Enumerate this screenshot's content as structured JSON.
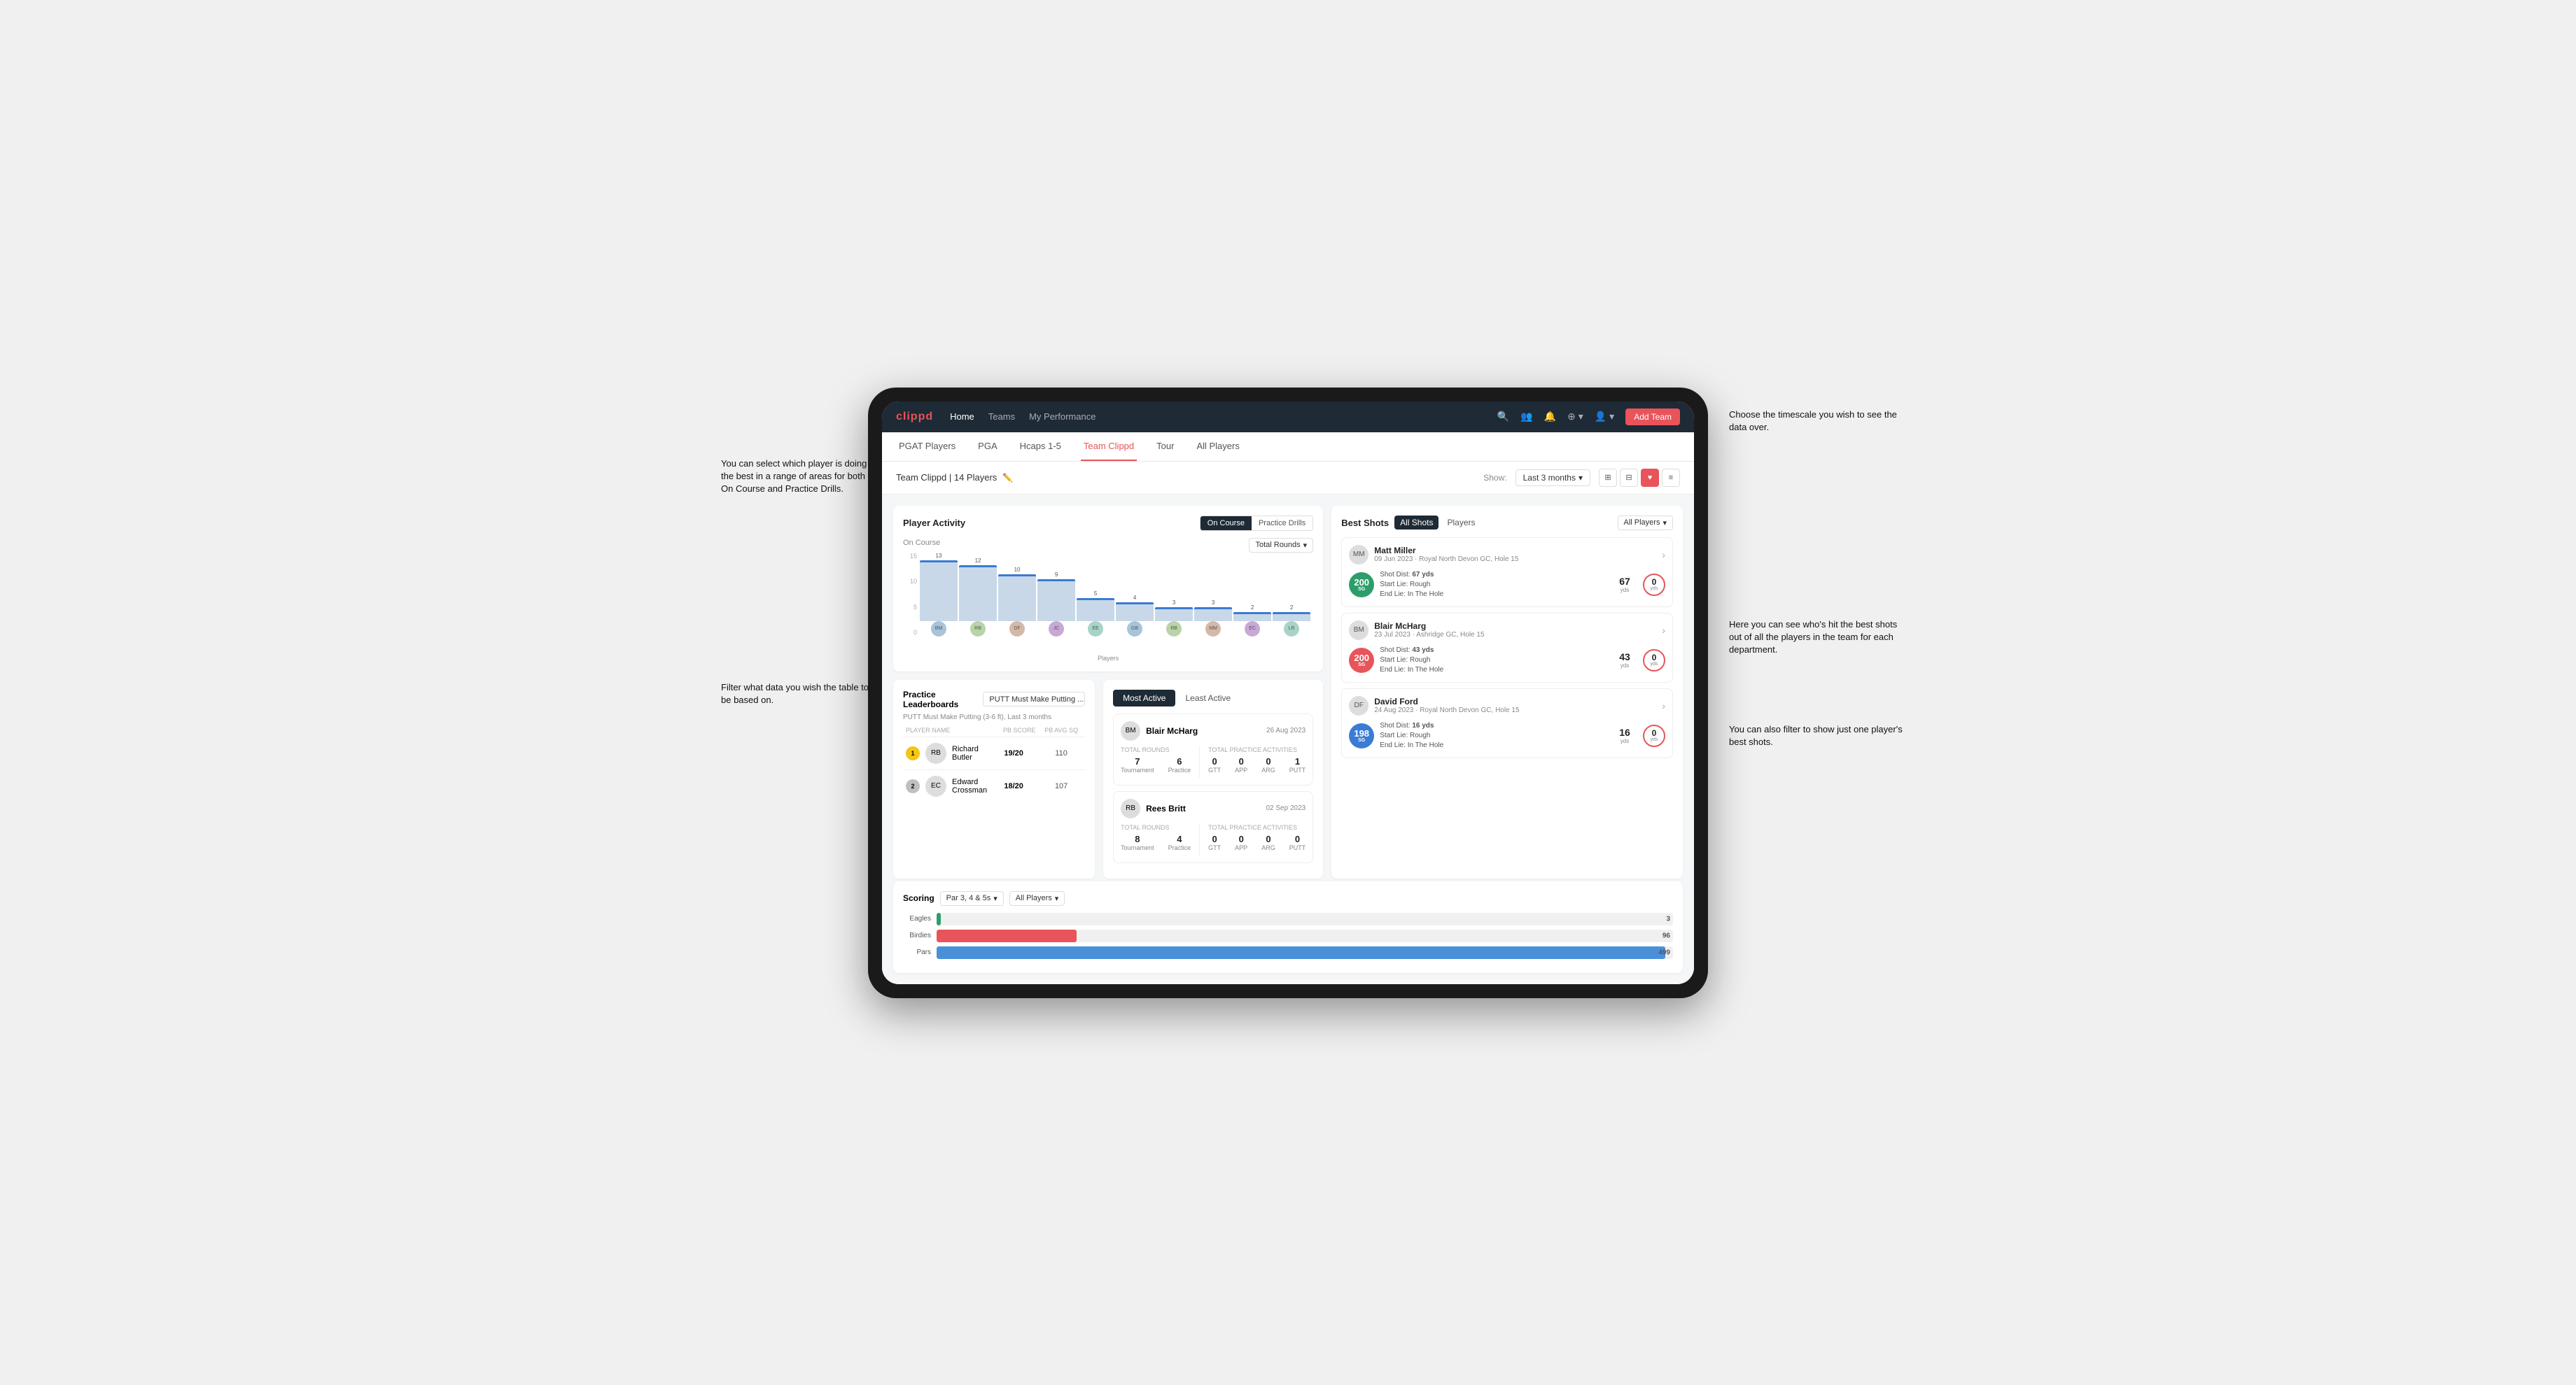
{
  "annotations": {
    "tl": "You can select which player is doing the best in a range of areas for both On Course and Practice Drills.",
    "bl": "Filter what data you wish the table to be based on.",
    "tr": "Choose the timescale you wish to see the data over.",
    "mr": "Here you can see who's hit the best shots out of all the players in the team for each department.",
    "br": "You can also filter to show just one player's best shots."
  },
  "nav": {
    "logo": "clippd",
    "links": [
      "Home",
      "Teams",
      "My Performance"
    ],
    "icons": [
      "search",
      "users",
      "bell",
      "circle-plus",
      "avatar"
    ],
    "add_team_btn": "Add Team"
  },
  "sub_tabs": {
    "tabs": [
      "PGAT Players",
      "PGA",
      "Hcaps 1-5",
      "Team Clippd",
      "Tour",
      "All Players"
    ],
    "active": "Team Clippd"
  },
  "team_header": {
    "title": "Team Clippd | 14 Players",
    "show_label": "Show:",
    "show_value": "Last 3 months",
    "view_modes": [
      "grid-4",
      "grid",
      "heart",
      "list"
    ]
  },
  "player_activity": {
    "title": "Player Activity",
    "toggle_buttons": [
      "On Course",
      "Practice Drills"
    ],
    "active_toggle": "On Course",
    "section_label": "On Course",
    "chart_filter": "Total Rounds",
    "y_axis": [
      "15",
      "10",
      "5",
      "0"
    ],
    "bars": [
      {
        "name": "B. McHarg",
        "value": 13,
        "height": 87
      },
      {
        "name": "R. Britt",
        "value": 12,
        "height": 80
      },
      {
        "name": "D. Ford",
        "value": 10,
        "height": 67
      },
      {
        "name": "J. Coles",
        "value": 9,
        "height": 60
      },
      {
        "name": "E. Ebert",
        "value": 5,
        "height": 33
      },
      {
        "name": "G. Billingham",
        "value": 4,
        "height": 27
      },
      {
        "name": "R. Butler",
        "value": 3,
        "height": 20
      },
      {
        "name": "M. Miller",
        "value": 3,
        "height": 20
      },
      {
        "name": "E. Crossman",
        "value": 2,
        "height": 13
      },
      {
        "name": "L. Robertson",
        "value": 2,
        "height": 13
      }
    ],
    "x_label": "Players"
  },
  "best_shots": {
    "title": "Best Shots",
    "tabs": [
      "All Shots",
      "Players"
    ],
    "active_tab": "All Shots",
    "filter_label": "All Players",
    "players": [
      {
        "name": "Matt Miller",
        "detail": "09 Jun 2023 · Royal North Devon GC, Hole 15",
        "sg_value": "200",
        "sg_label": "SG",
        "shot_dist": "67 yds",
        "start_lie": "Rough",
        "end_lie": "In The Hole",
        "metric1_val": "67",
        "metric1_unit": "yds",
        "metric2_val": "0",
        "metric2_unit": "yds"
      },
      {
        "name": "Blair McHarg",
        "detail": "23 Jul 2023 · Ashridge GC, Hole 15",
        "sg_value": "200",
        "sg_label": "SG",
        "shot_dist": "43 yds",
        "start_lie": "Rough",
        "end_lie": "In The Hole",
        "metric1_val": "43",
        "metric1_unit": "yds",
        "metric2_val": "0",
        "metric2_unit": "yds"
      },
      {
        "name": "David Ford",
        "detail": "24 Aug 2023 · Royal North Devon GC, Hole 15",
        "sg_value": "198",
        "sg_label": "SG",
        "shot_dist": "16 yds",
        "start_lie": "Rough",
        "end_lie": "In The Hole",
        "metric1_val": "16",
        "metric1_unit": "yds",
        "metric2_val": "0",
        "metric2_unit": "yds"
      }
    ]
  },
  "practice_leaderboards": {
    "title": "Practice Leaderboards",
    "dropdown_label": "PUTT Must Make Putting ...",
    "subtitle": "PUTT Must Make Putting (3-6 ft), Last 3 months",
    "columns": [
      "Player Name",
      "PB Score",
      "PB Avg SQ"
    ],
    "rows": [
      {
        "rank": "1",
        "rank_type": "gold",
        "name": "Richard Butler",
        "pb_score": "19/20",
        "pb_avg": "110"
      },
      {
        "rank": "2",
        "rank_type": "silver",
        "name": "Edward Crossman",
        "pb_score": "18/20",
        "pb_avg": "107"
      }
    ]
  },
  "most_active": {
    "tabs": [
      "Most Active",
      "Least Active"
    ],
    "active_tab": "Most Active",
    "players": [
      {
        "name": "Blair McHarg",
        "date": "26 Aug 2023",
        "total_rounds_label": "Total Rounds",
        "tournament_val": "7",
        "practice_val": "6",
        "total_practice_label": "Total Practice Activities",
        "gtt_val": "0",
        "app_val": "0",
        "arg_val": "0",
        "putt_val": "1"
      },
      {
        "name": "Rees Britt",
        "date": "02 Sep 2023",
        "total_rounds_label": "Total Rounds",
        "tournament_val": "8",
        "practice_val": "4",
        "total_practice_label": "Total Practice Activities",
        "gtt_val": "0",
        "app_val": "0",
        "arg_val": "0",
        "putt_val": "0"
      }
    ]
  },
  "scoring": {
    "title": "Scoring",
    "dropdown1_label": "Par 3, 4 & 5s",
    "dropdown2_label": "All Players",
    "bars": [
      {
        "label": "Eagles",
        "value": 3,
        "max": 500,
        "color": "#2d9e6b"
      },
      {
        "label": "Birdies",
        "value": 96,
        "max": 500,
        "color": "#e8545a"
      },
      {
        "label": "Pars",
        "value": 499,
        "max": 500,
        "color": "#4a90d9"
      }
    ]
  }
}
